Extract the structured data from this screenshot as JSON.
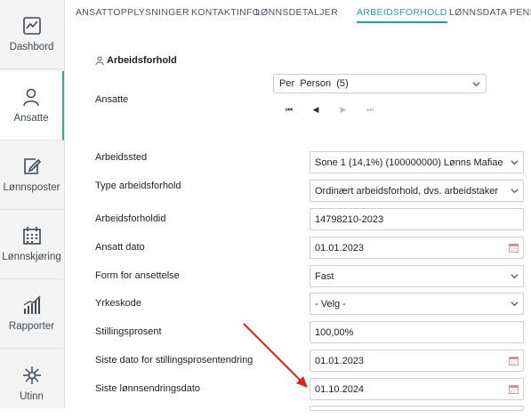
{
  "sidebar": {
    "items": [
      {
        "label": "Dashbord",
        "icon": "dashboard-icon",
        "active": false
      },
      {
        "label": "Ansatte",
        "icon": "person-icon",
        "active": true
      },
      {
        "label": "Lønnsposter",
        "icon": "edit-icon",
        "active": false
      },
      {
        "label": "Lønnskjøring",
        "icon": "calendar-icon",
        "active": false
      },
      {
        "label": "Rapporter",
        "icon": "bar-chart-icon",
        "active": false
      },
      {
        "label": "Utinn",
        "icon": "network-icon",
        "active": false
      }
    ]
  },
  "tabs": [
    {
      "label": "ANSATTOPPLYSNINGER",
      "active": false
    },
    {
      "label": "KONTAKTINFO",
      "active": false
    },
    {
      "label": "LØNNSDETALJER",
      "active": false
    },
    {
      "label": "ARBEIDSFORHOLD",
      "active": true
    },
    {
      "label": "LØNNSDATA PENS",
      "active": false
    }
  ],
  "section": {
    "title": "Arbeidsforhold"
  },
  "employees": {
    "label": "Ansatte",
    "selected": "Per  Person  (5)"
  },
  "fields": [
    {
      "label": "Arbeidssted",
      "value": "Sone 1 (14,1%) (100000000) Lønns Mafiae",
      "type": "select"
    },
    {
      "label": "Type arbeidsforhold",
      "value": "Ordinært arbeidsforhold, dvs. arbeidstaker",
      "type": "select"
    },
    {
      "label": "Arbeidsforholdid",
      "value": "14798210-2023",
      "type": "text"
    },
    {
      "label": "Ansatt dato",
      "value": "01.01.2023",
      "type": "date"
    },
    {
      "label": "Form for ansettelse",
      "value": "Fast",
      "type": "select"
    },
    {
      "label": "Yrkeskode",
      "value": "- Velg -",
      "type": "select"
    },
    {
      "label": "Stillingsprosent",
      "value": "100,00%",
      "type": "text"
    },
    {
      "label": "Siste dato for stillingsprosentendring",
      "value": "01.01.2023",
      "type": "date"
    },
    {
      "label": "Siste lønnsendringsdato",
      "value": "01.10.2024",
      "type": "date"
    }
  ],
  "colors": {
    "accent": "#2f9e94",
    "arrow": "#e02020"
  }
}
